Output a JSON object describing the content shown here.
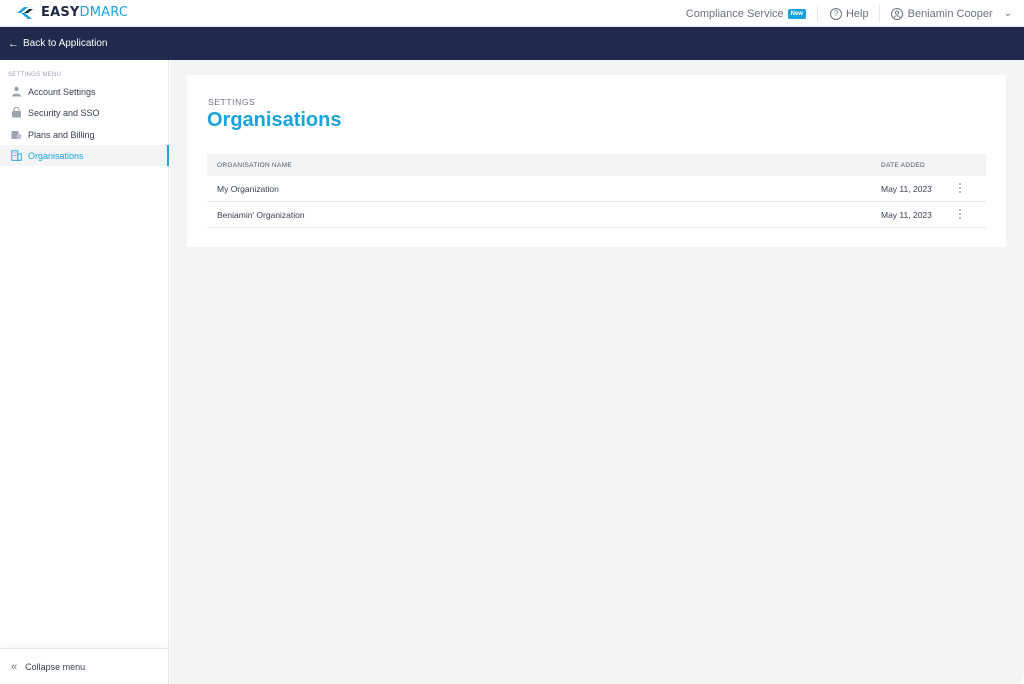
{
  "brand": {
    "name_part1": "EASY",
    "name_part2": "DMARC",
    "accent": "#1aa3dc",
    "navy": "#1f2a4d"
  },
  "header": {
    "compliance_label": "Compliance Service",
    "compliance_badge": "New",
    "help_label": "Help",
    "user_name": "Beniamin Cooper"
  },
  "navbar": {
    "back_label": "Back to Application"
  },
  "sidebar": {
    "title": "SETTINGS MENU",
    "items": [
      {
        "label": "Account Settings",
        "icon": "user-settings-icon"
      },
      {
        "label": "Security and SSO",
        "icon": "security-lock-icon"
      },
      {
        "label": "Plans and Billing",
        "icon": "billing-icon"
      },
      {
        "label": "Organisations",
        "icon": "building-icon",
        "active": true
      }
    ],
    "collapse_label": "Collapse menu"
  },
  "main": {
    "breadcrumb": "SETTINGS",
    "title": "Organisations",
    "table": {
      "columns": [
        "ORGANISATION NAME",
        "DATE ADDED"
      ],
      "rows": [
        {
          "name": "My Organization",
          "date": "May 11, 2023"
        },
        {
          "name": "Beniamin' Organization",
          "date": "May 11, 2023"
        }
      ]
    }
  }
}
